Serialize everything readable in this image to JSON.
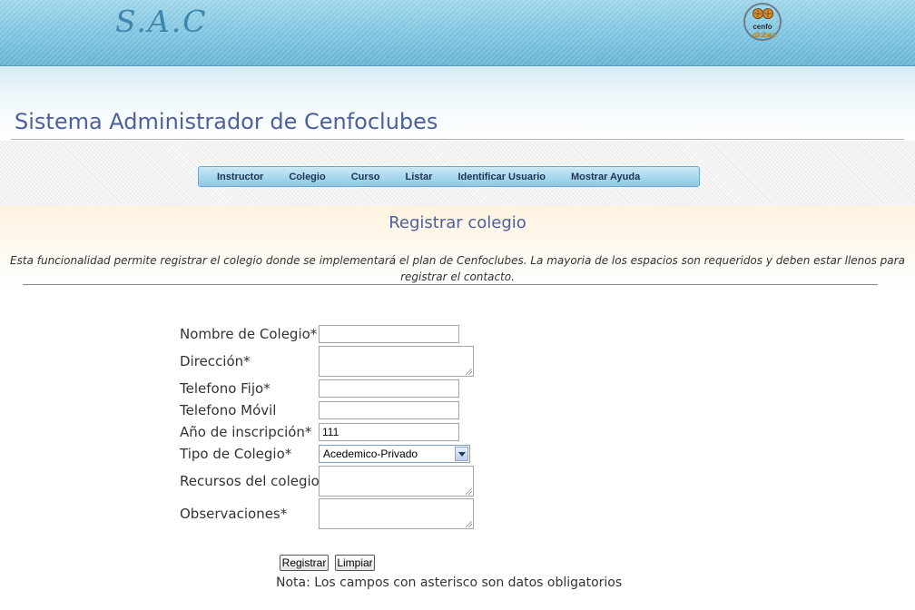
{
  "brand": {
    "name": "S.A.C",
    "logo_text": "cenfo clubes"
  },
  "header": {
    "title": "Sistema Administrador de Cenfoclubes"
  },
  "nav": {
    "items": [
      {
        "label": "Instructor"
      },
      {
        "label": "Colegio"
      },
      {
        "label": "Curso"
      },
      {
        "label": "Listar"
      },
      {
        "label": "Identificar Usuario"
      },
      {
        "label": "Mostrar Ayuda"
      }
    ]
  },
  "section": {
    "title": "Registrar colegio",
    "description": "Esta funcionalidad permite registrar el colegio donde se implementará el plan de Cenfoclubes. La mayoria de los espacios son requeridos y deben estar llenos para registrar el contacto."
  },
  "form": {
    "fields": {
      "nombre": {
        "label": "Nombre de Colegio*",
        "value": ""
      },
      "direccion": {
        "label": "Dirección*",
        "value": ""
      },
      "telefono_fijo": {
        "label": "Telefono Fijo*",
        "value": ""
      },
      "telefono_movil": {
        "label": "Telefono Móvil",
        "value": ""
      },
      "anio": {
        "label": "Año de inscripción*",
        "value": "111"
      },
      "tipo": {
        "label": "Tipo de Colegio*",
        "value": "Acedemico-Privado"
      },
      "recursos": {
        "label": "Recursos del colegio*",
        "value": ""
      },
      "observaciones": {
        "label": "Observaciones*",
        "value": ""
      }
    },
    "buttons": {
      "register": "Registrar",
      "clear": "Limpiar"
    },
    "note": "Nota: Los campos con asterisco son datos obligatorios"
  },
  "colors": {
    "banner": "#7cc3df",
    "title_text": "#4d5f9e",
    "nav_bar": "#a8d7ec",
    "content_band": "#fdf3df"
  },
  "icons": {
    "logo": "cenfoclubes-logo-icon",
    "select_arrow": "chevron-down-icon"
  }
}
